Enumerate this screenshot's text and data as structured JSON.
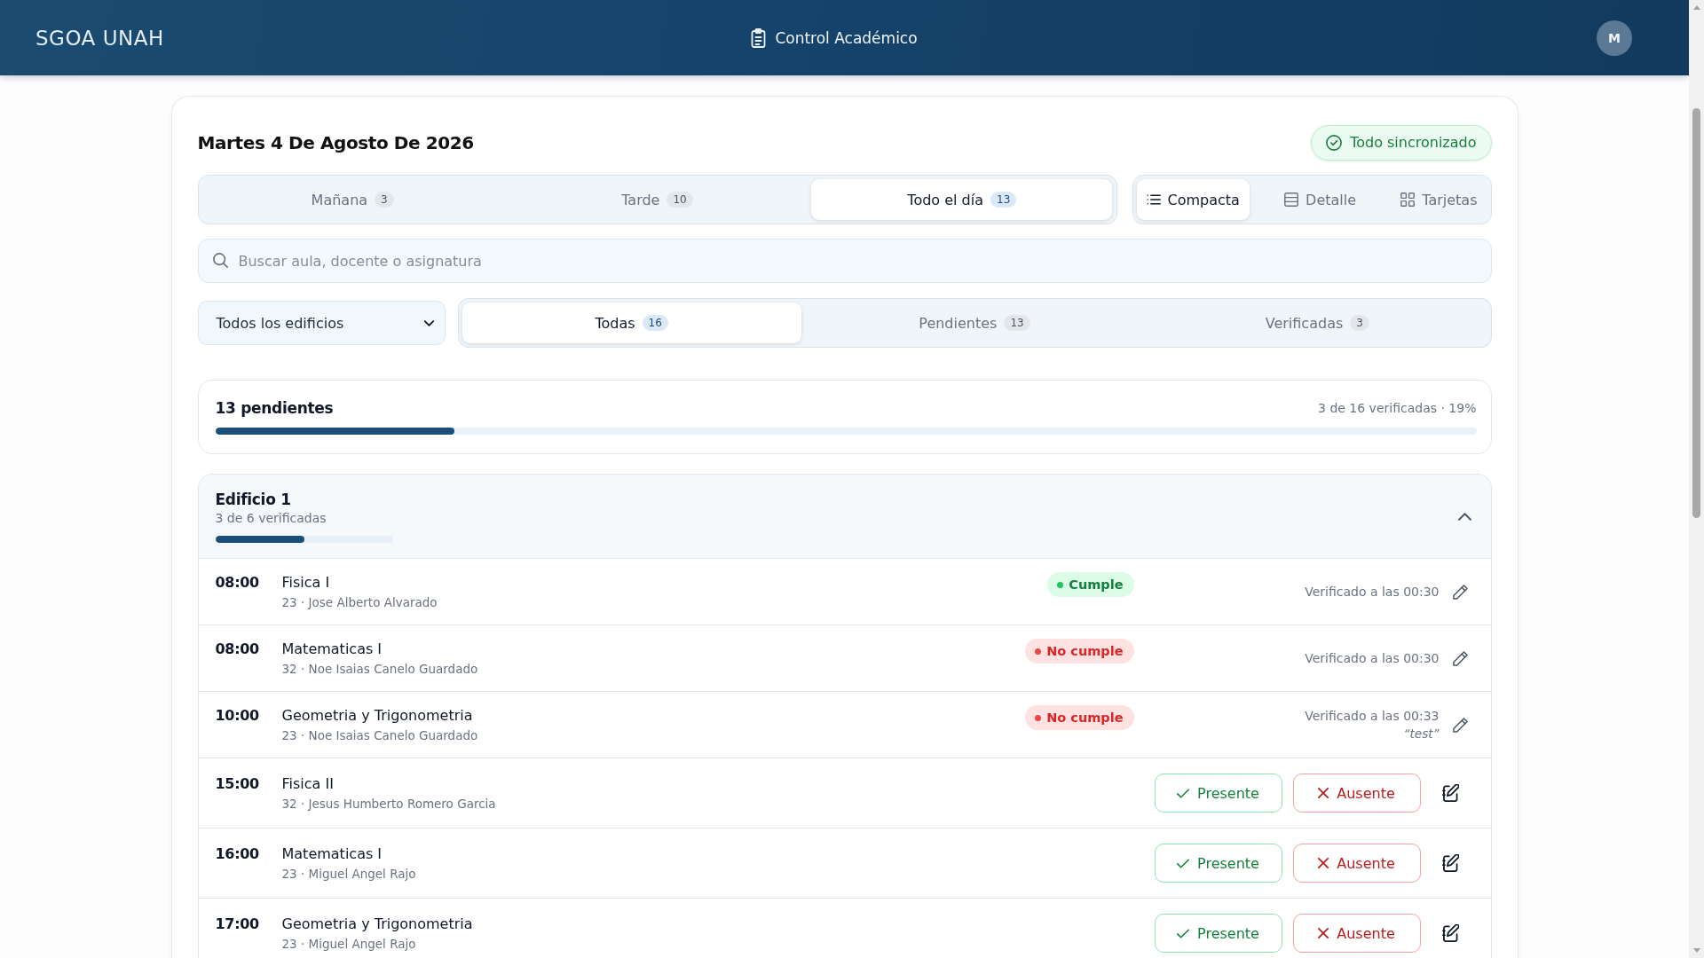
{
  "header": {
    "brand": "SGOA UNAH",
    "title": "Control Académico",
    "avatar": "M"
  },
  "day": {
    "title": "Martes 4 De Agosto De 2026",
    "sync": "Todo sincronizado"
  },
  "period_tabs": [
    {
      "label": "Mañana",
      "count": "3",
      "selected": false
    },
    {
      "label": "Tarde",
      "count": "10",
      "selected": false
    },
    {
      "label": "Todo el día",
      "count": "13",
      "selected": true
    }
  ],
  "view_modes": [
    {
      "label": "Compacta",
      "kind": "compact",
      "selected": true
    },
    {
      "label": "Detalle",
      "kind": "detail",
      "selected": false
    },
    {
      "label": "Tarjetas",
      "kind": "cards",
      "selected": false
    }
  ],
  "search": {
    "placeholder": "Buscar aula, docente o asignatura"
  },
  "building_select": {
    "value": "Todos los edificios"
  },
  "status_tabs": [
    {
      "label": "Todas",
      "count": "16",
      "selected": true
    },
    {
      "label": "Pendientes",
      "count": "13",
      "selected": false
    },
    {
      "label": "Verificadas",
      "count": "3",
      "selected": false
    }
  ],
  "progress": {
    "title": "13 pendientes",
    "reading": "3 de 16 verificadas · 19%",
    "level": 0.19
  },
  "buildings": [
    {
      "name": "Edificio 1",
      "reading": "3 de 6 verificadas",
      "level": 0.5,
      "expanded": true,
      "rows": [
        {
          "time": "08:00",
          "subject": "Fisica I",
          "detail": "23 · Jose Alberto Alvarado",
          "kind": "verified",
          "status": {
            "label": "Cumple",
            "kind": "ok"
          },
          "verified": "Verificado a las 00:30"
        },
        {
          "time": "08:00",
          "subject": "Matematicas I",
          "detail": "32 · Noe Isaias Canelo Guardado",
          "kind": "verified",
          "status": {
            "label": "No cumple",
            "kind": "fail"
          },
          "verified": "Verificado a las 00:30"
        },
        {
          "time": "10:00",
          "subject": "Geometria y Trigonometria",
          "detail": "23 · Noe Isaias Canelo Guardado",
          "kind": "verified",
          "status": {
            "label": "No cumple",
            "kind": "fail"
          },
          "verified": "Verificado a las 00:33",
          "note": "“test”"
        },
        {
          "time": "15:00",
          "subject": "Fisica II",
          "detail": "32 · Jesus Humberto Romero Garcia",
          "kind": "pending",
          "actions": [
            {
              "label": "Presente",
              "kind": "present"
            },
            {
              "label": "Ausente",
              "kind": "absent"
            }
          ]
        },
        {
          "time": "16:00",
          "subject": "Matematicas I",
          "detail": "23 · Miguel Angel Rajo",
          "kind": "pending",
          "actions": [
            {
              "label": "Presente",
              "kind": "present"
            },
            {
              "label": "Ausente",
              "kind": "absent"
            }
          ]
        },
        {
          "time": "17:00",
          "subject": "Geometria y Trigonometria",
          "detail": "23 · Miguel Angel Rajo",
          "kind": "pending",
          "actions": [
            {
              "label": "Presente",
              "kind": "present"
            },
            {
              "label": "Ausente",
              "kind": "absent"
            }
          ]
        }
      ]
    }
  ]
}
